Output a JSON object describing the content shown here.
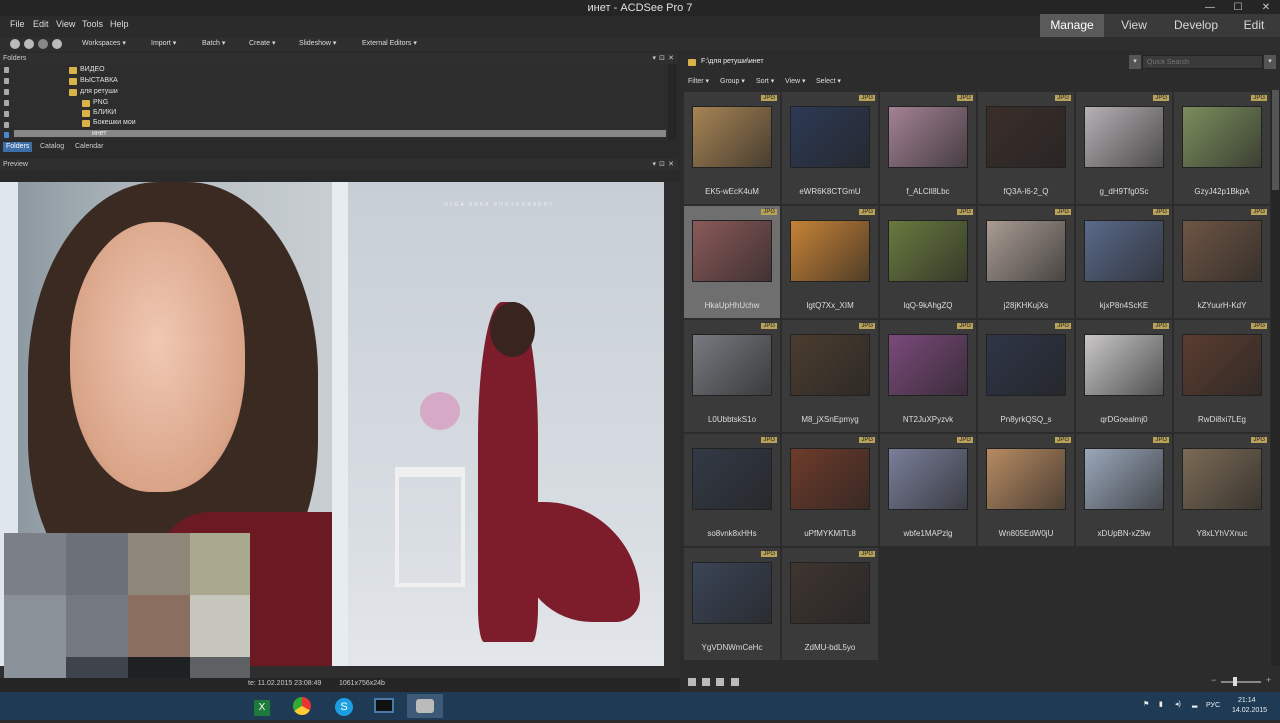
{
  "window": {
    "title": "инет - ACDSee Pro 7"
  },
  "menu": [
    "File",
    "Edit",
    "View",
    "Tools",
    "Help"
  ],
  "modes": [
    {
      "label": "Manage",
      "active": true
    },
    {
      "label": "View",
      "active": false
    },
    {
      "label": "Develop",
      "active": false
    },
    {
      "label": "Edit",
      "active": false
    }
  ],
  "toolbar": {
    "items": [
      "Workspaces ▾",
      "Import ▾",
      "Batch ▾",
      "Create ▾",
      "Slideshow ▾",
      "External Editors ▾"
    ]
  },
  "folders": {
    "title": "Folders",
    "tree": [
      {
        "label": "ВИДЕО",
        "selected": false
      },
      {
        "label": "ВЫСТАВКА",
        "selected": false
      },
      {
        "label": "для ретуши",
        "selected": false
      },
      {
        "label": "PNG",
        "selected": false
      },
      {
        "label": "БЛИКИ",
        "selected": false
      },
      {
        "label": "Бокешки мои",
        "selected": false
      },
      {
        "label": "инет",
        "selected": true
      }
    ],
    "tabs": [
      {
        "label": "Folders",
        "active": true
      },
      {
        "label": "Catalog",
        "active": false
      },
      {
        "label": "Calendar",
        "active": false
      }
    ]
  },
  "preview": {
    "title": "Preview",
    "watermark": "OLGA ANNA PHOTOGRAPHY"
  },
  "status": {
    "date": "te: 11.02.2015 23:08:49",
    "dims": "1061x756x24b"
  },
  "browser": {
    "path": "F:\\для ретуши\\инет",
    "search_placeholder": "Quick Search",
    "filters": [
      "Filter ▾",
      "Group ▾",
      "Sort ▾",
      "View ▾",
      "Select ▾"
    ],
    "badge": "JPG",
    "files": [
      {
        "name": "EK5-wEcK4uM",
        "color": "#a78454",
        "selected": false
      },
      {
        "name": "eWR6K8CTGmU",
        "color": "#2d3a55",
        "selected": false
      },
      {
        "name": "f_ALCll8Lbc",
        "color": "#a38294",
        "selected": false
      },
      {
        "name": "fQ3A-l6-2_Q",
        "color": "#3b2e2a",
        "selected": false
      },
      {
        "name": "g_dH9Tfg0Sc",
        "color": "#b6b1b5",
        "selected": false
      },
      {
        "name": "GzyJ42p1BkpA",
        "color": "#7b8e5d",
        "selected": false
      },
      {
        "name": "HkaUpHhUchw",
        "color": "#8b5a5a",
        "selected": true
      },
      {
        "name": "IgtQ7Xx_XIM",
        "color": "#c68236",
        "selected": false
      },
      {
        "name": "lqQ-9kAhgZQ",
        "color": "#697a3f",
        "selected": false
      },
      {
        "name": "j28jKHKujXs",
        "color": "#a99c93",
        "selected": false
      },
      {
        "name": "kjxP8n4ScKE",
        "color": "#5a6a8a",
        "selected": false
      },
      {
        "name": "kZYuurH-KdY",
        "color": "#6e5544",
        "selected": false
      },
      {
        "name": "L0UbbtskS1o",
        "color": "#777a80",
        "selected": false
      },
      {
        "name": "M8_jXSnEpmyg",
        "color": "#4b3d2f",
        "selected": false
      },
      {
        "name": "NT2JuXPyzvk",
        "color": "#7a4a7a",
        "selected": false
      },
      {
        "name": "Pn8yrkQSQ_s",
        "color": "#2e3546",
        "selected": false
      },
      {
        "name": "qrDGoealmj0",
        "color": "#c9c7c8",
        "selected": false
      },
      {
        "name": "RwDi8xi7LEg",
        "color": "#5b3d30",
        "selected": false
      },
      {
        "name": "so8vnk8xHHs",
        "color": "#333a46",
        "selected": false
      },
      {
        "name": "uPfMYKMiTL8",
        "color": "#6e3b2a",
        "selected": false
      },
      {
        "name": "wbfe1MAPzlg",
        "color": "#7a7f9a",
        "selected": false
      },
      {
        "name": "Wn805EdW0jU",
        "color": "#b78b62",
        "selected": false
      },
      {
        "name": "xDUpBN-xZ9w",
        "color": "#9aa7ba",
        "selected": false
      },
      {
        "name": "Y8xLYhVXnuc",
        "color": "#7b6a55",
        "selected": false
      },
      {
        "name": "YgVDNWmCeHc",
        "color": "#3b4556",
        "selected": false
      },
      {
        "name": "ZdMU-bdL5yo",
        "color": "#3e3530",
        "selected": false
      }
    ]
  },
  "taskbar": {
    "lang": "РУС",
    "time": "21:14",
    "date": "14.02.2015"
  },
  "colors": {
    "accent": "#3d6ea8",
    "title_bar": "#252525",
    "taskbar": "#1f3a55",
    "folder": "#d8b34a"
  }
}
